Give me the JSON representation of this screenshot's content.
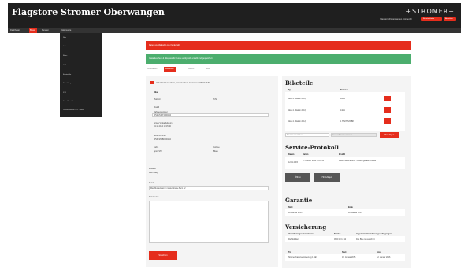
{
  "header": {
    "title": "Flagstore Stromer Oberwangen",
    "logo": "+STROMER+",
    "email": "flagstore@oberwangen.stromer.ch",
    "btn_account": "Benutzerkonto",
    "btn_logout": "Abmelden"
  },
  "nav": {
    "items": [
      "Dashboard",
      "Bikes",
      "Kunden",
      "Dokumente"
    ]
  },
  "dropdown": {
    "items": [
      "Neu",
      "Liste",
      "Bikes",
      "ST2",
      "Ersatzteile",
      "Bestellung",
      "ST1",
      "Sale / Rental",
      "Verkaufsdatum ST1 / Bikes"
    ]
  },
  "alerts": {
    "error": "Daten unvollständig oder fehlerhaft",
    "success": "Garantieschein & Bikepass für Kunde erfolgreich erstellt und gespeichert"
  },
  "tabs": [
    "Stammdaten",
    "Bikedetails",
    "Service",
    "Notiz"
  ],
  "left": {
    "checkbox_label": "Verkaufsdatum erfasst, Garantieschein 12 Januar 2015 07:39:53",
    "bike_heading": "Bike",
    "plattform_label": "Plattform",
    "plattform_value": "ST2",
    "modell_label": "Modell",
    "rahmennummer_label": "Rahmennummer",
    "rahmennummer_value": "WS2ST2ST2000134",
    "erst_label": "Erstes Verkaufsdatum",
    "erst_value": "04.12.2014 10:15:40",
    "seriennummer_label": "Seriennummer",
    "seriennummer_value": "WS31ST2B0000134",
    "farbe_label": "Farbe",
    "farbe_value": "Sport ST2",
    "groesse_label": "Grösse",
    "groesse_value": "Black",
    "status_label": "Zustand",
    "status_value": "Bike ready",
    "kunde_label": "Kunde",
    "kunde_value": "Max Mustermann / musterstrasse Bern 12",
    "notes_label": "Kommentar",
    "save_button": "Speichern"
  },
  "biketeile": {
    "title": "Biketeile",
    "col_typ": "Typ",
    "col_nummer": "Nummer",
    "rows": [
      {
        "typ": "Akku 1 (Datum 2012)",
        "nummer": "12/11"
      },
      {
        "typ": "Akku 1 (Datum 2010)",
        "nummer": "13/11"
      },
      {
        "typ": "Akku 1 (Datum 2012)",
        "nummer": "1 ST2/ST2/RB8"
      }
    ],
    "select_placeholder": "Biketeil auswählen",
    "input_placeholder": "Neues Biketeil erfassen",
    "add_button": "Hinzufügen"
  },
  "service": {
    "title": "Service-Protokoll",
    "col_date": "Datum",
    "col_name": "Datum",
    "col_info": "Erstellt",
    "row_date": "12.01.2015",
    "row_name": "8. Oktober 2014 13:01:33",
    "row_info": "Bikefit Service Notiz / Leistungs­daten Kunde",
    "btn_open": "Öffnen",
    "btn_new": "Hinzufügen"
  },
  "garantie": {
    "title": "Garantie",
    "col_start": "Start",
    "col_end": "Ende",
    "start": "12. Januar 2015",
    "end": "12. Januar 2017"
  },
  "versicherung": {
    "title": "Versicherung",
    "col1": "Versicherungsunternehmen",
    "col2": "Telefon",
    "col3": "Allgemeine Versicherungsbedingungen",
    "v1": "Die Mobiliar",
    "v2": "0900 10 11 12",
    "v3": "Das Bike ist versichert",
    "col_typ": "Typ",
    "col_start": "Start",
    "col_ende": "Ende",
    "typ": "Stromer Kaskoversicherung 1 Jahr",
    "start": "12. Januar 2015",
    "ende": "12. Januar 2016"
  }
}
